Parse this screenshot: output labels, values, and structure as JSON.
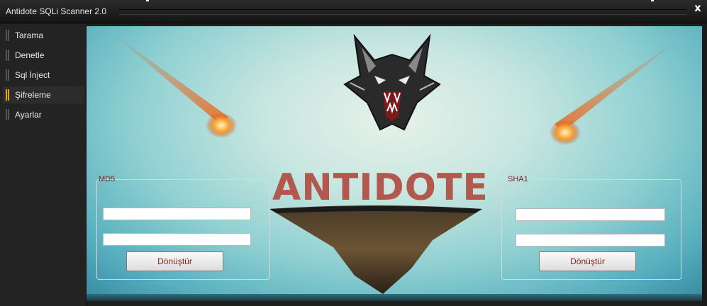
{
  "window": {
    "title": "Antidote SQLi Scanner 2.0",
    "close_label": "x"
  },
  "sidebar": {
    "items": [
      {
        "label": "Tarama",
        "active": false
      },
      {
        "label": "Denetle",
        "active": false
      },
      {
        "label": "Sql İnject",
        "active": false
      },
      {
        "label": "Şifreleme",
        "active": true
      },
      {
        "label": "Ayarlar",
        "active": false
      }
    ]
  },
  "banner": {
    "logo_text": "ANTIDOTE",
    "logo_color": "#b3584f"
  },
  "md5_group": {
    "title": "MD5",
    "input1_value": "",
    "input2_value": "",
    "button_label": "Dönüştür"
  },
  "sha1_group": {
    "title": "SHA1",
    "input1_value": "",
    "input2_value": "",
    "button_label": "Dönüştür"
  },
  "icons": {
    "wolf": "wolf-head-icon",
    "meteor": "meteor-icon",
    "island": "floating-island-icon"
  }
}
